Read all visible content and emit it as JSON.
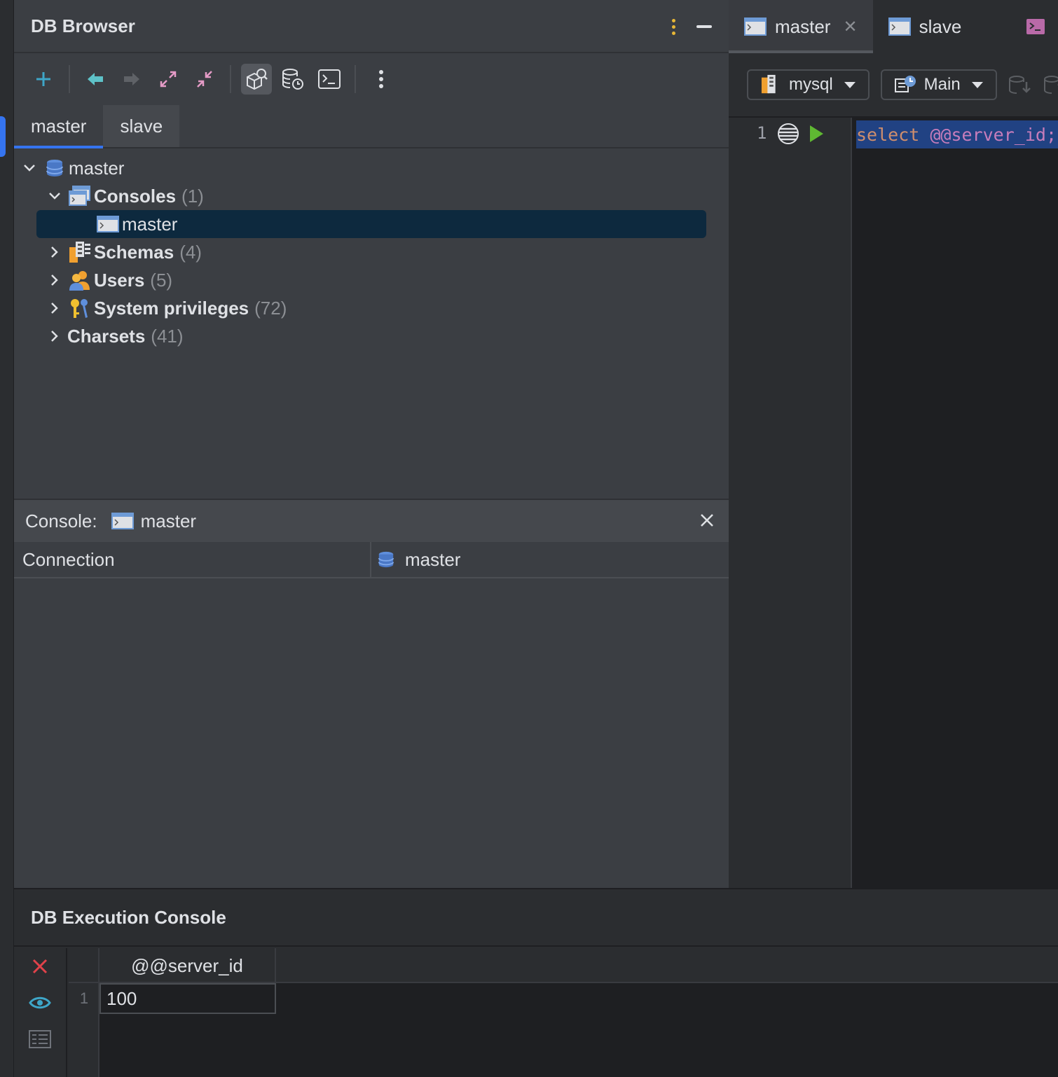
{
  "db_browser": {
    "title": "DB Browser",
    "tabs": [
      {
        "label": "master"
      },
      {
        "label": "slave"
      }
    ],
    "tree": {
      "root": "master",
      "consoles": {
        "label": "Consoles",
        "count": "(1)",
        "child": "master"
      },
      "schemas": {
        "label": "Schemas",
        "count": "(4)"
      },
      "users": {
        "label": "Users",
        "count": "(5)"
      },
      "system_privileges": {
        "label": "System privileges",
        "count": "(72)"
      },
      "charsets": {
        "label": "Charsets",
        "count": "(41)"
      }
    }
  },
  "console_panel": {
    "label": "Console:",
    "name": "master",
    "connection_key": "Connection",
    "connection_value": "master"
  },
  "editor": {
    "tabs": [
      {
        "label": "master"
      },
      {
        "label": "slave"
      }
    ],
    "close_glyph": "✕",
    "schema_combo": "mysql",
    "session_combo": "Main",
    "line_number": "1",
    "code_keyword": "select",
    "code_rest": "@@server_id;"
  },
  "exec_console": {
    "title": "DB Execution Console",
    "column": "@@server_id",
    "row_number": "1",
    "value": "100"
  },
  "colors": {
    "accent": "#3574f0",
    "selection": "#0d293e",
    "keyword": "#cf8e6d"
  }
}
